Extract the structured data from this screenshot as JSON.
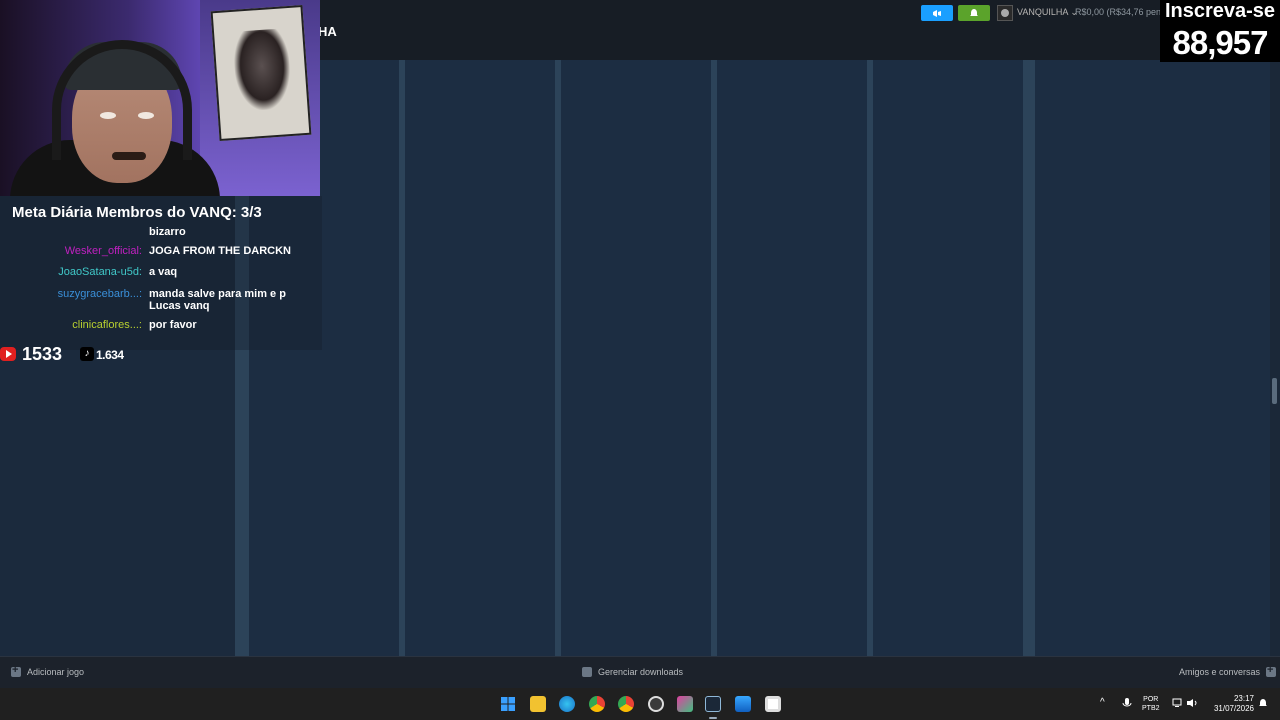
{
  "steam": {
    "nav_label_partial": "HA",
    "user_name": "VANQUILHA ⌄",
    "wallet": "R$0,00 (R$34,76 pend",
    "colors": {
      "announce": "#1a9fff",
      "notify": "#5ba32b",
      "background": "#1b2838"
    }
  },
  "subscribe": {
    "label": "Inscreva-se",
    "count": "88,957"
  },
  "overlay": {
    "goal": "Meta Diária Membros do VANQ: 3/3",
    "chat": [
      {
        "author": "",
        "text": "bizarro",
        "color": "#ffffff"
      },
      {
        "author": "Wesker_official:",
        "text": "JOGA FROM THE DARCKN",
        "color": "#c020c0"
      },
      {
        "author": "JoaoSatana-u5d:",
        "text": "a vaq",
        "color": "#40c8c8"
      },
      {
        "author": "suzygracebarb...:",
        "text": "manda salve para mim e p Lucas vanq",
        "color": "#3a8fd8"
      },
      {
        "author": "clinicaflores...:",
        "text": "por favor",
        "color": "#b8d030"
      }
    ],
    "youtube_count": "1533",
    "tiktok_count": "1.634"
  },
  "bottombar": {
    "add_game": "Adicionar jogo",
    "downloads": "Gerenciar downloads",
    "friends": "Amigos e conversas"
  },
  "taskbar": {
    "icons": [
      "windows-start-icon",
      "file-explorer-icon",
      "edge-icon",
      "chrome-icon",
      "chrome-dev-icon",
      "obs-icon",
      "app-icon",
      "steam-icon",
      "store-icon",
      "app2-icon"
    ],
    "lang_line1": "POR",
    "lang_line2": "PTB2",
    "time": "23:17",
    "date": "31/07/2026"
  }
}
